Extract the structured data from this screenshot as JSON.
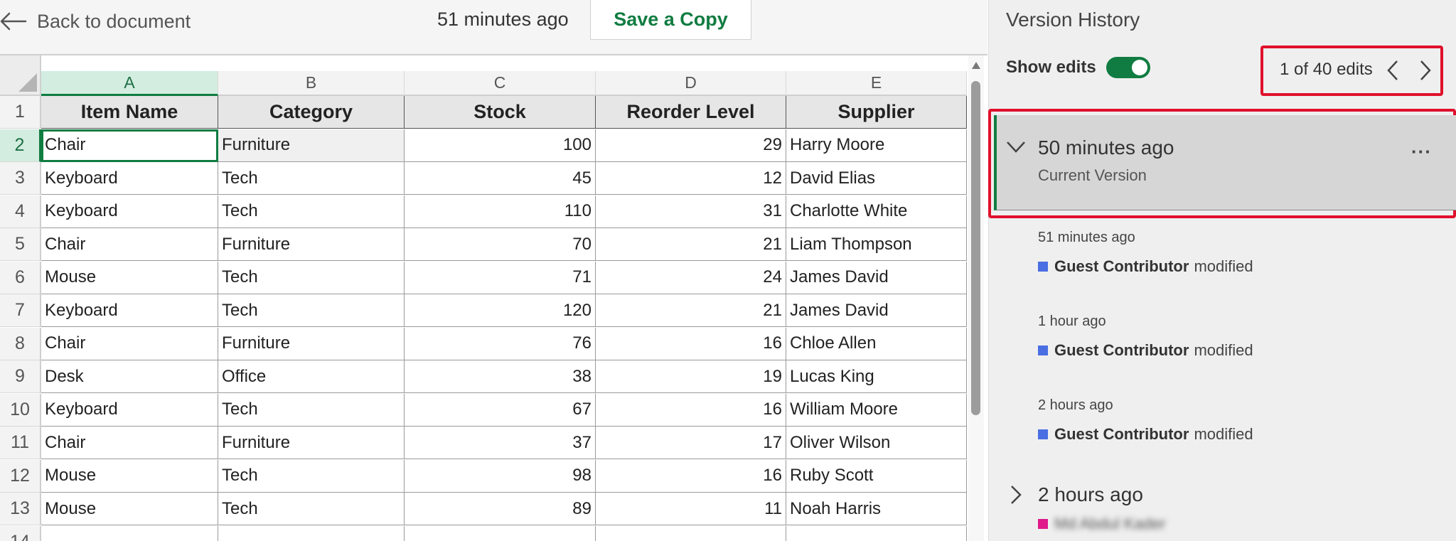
{
  "topbar": {
    "back_label": "Back to document",
    "time": "51 minutes ago",
    "save_label": "Save a Copy"
  },
  "sheet": {
    "columns": [
      "A",
      "B",
      "C",
      "D",
      "E"
    ],
    "row_numbers": [
      "1",
      "2",
      "3",
      "4",
      "5",
      "6",
      "7",
      "8",
      "9",
      "10",
      "11",
      "12",
      "13",
      "14"
    ],
    "header": [
      "Item Name",
      "Category",
      "Stock",
      "Reorder Level",
      "Supplier"
    ],
    "rows": [
      [
        "Chair",
        "Furniture",
        "100",
        "29",
        "Harry Moore"
      ],
      [
        "Keyboard",
        "Tech",
        "45",
        "12",
        "David Elias"
      ],
      [
        "Keyboard",
        "Tech",
        "110",
        "31",
        "Charlotte White"
      ],
      [
        "Chair",
        "Furniture",
        "70",
        "21",
        "Liam Thompson"
      ],
      [
        "Mouse",
        "Tech",
        "71",
        "24",
        "James David"
      ],
      [
        "Keyboard",
        "Tech",
        "120",
        "21",
        "James David"
      ],
      [
        "Chair",
        "Furniture",
        "76",
        "16",
        "Chloe Allen"
      ],
      [
        "Desk",
        "Office",
        "38",
        "19",
        "Lucas King"
      ],
      [
        "Keyboard",
        "Tech",
        "67",
        "16",
        "William Moore"
      ],
      [
        "Chair",
        "Furniture",
        "37",
        "17",
        "Oliver Wilson"
      ],
      [
        "Mouse",
        "Tech",
        "98",
        "16",
        "Ruby Scott"
      ],
      [
        "Mouse",
        "Tech",
        "89",
        "11",
        "Noah Harris"
      ]
    ]
  },
  "panel": {
    "title": "Version History",
    "show_edits_label": "Show edits",
    "show_edits_on": true,
    "edit_count": "1 of 40 edits",
    "current": {
      "time": "50 minutes ago",
      "subtitle": "Current Version",
      "more": "···"
    },
    "edits": [
      {
        "time": "51 minutes ago",
        "user": "Guest Contributor",
        "action": "modified"
      },
      {
        "time": "1 hour ago",
        "user": "Guest Contributor",
        "action": "modified"
      },
      {
        "time": "2 hours ago",
        "user": "Guest Contributor",
        "action": "modified"
      }
    ],
    "collapsed": {
      "time": "2 hours ago",
      "user": "Md Abdul Kader"
    }
  },
  "colors": {
    "accent": "#107c41",
    "highlight": "#e0102c",
    "edit_marker": "#4a6fe3"
  }
}
